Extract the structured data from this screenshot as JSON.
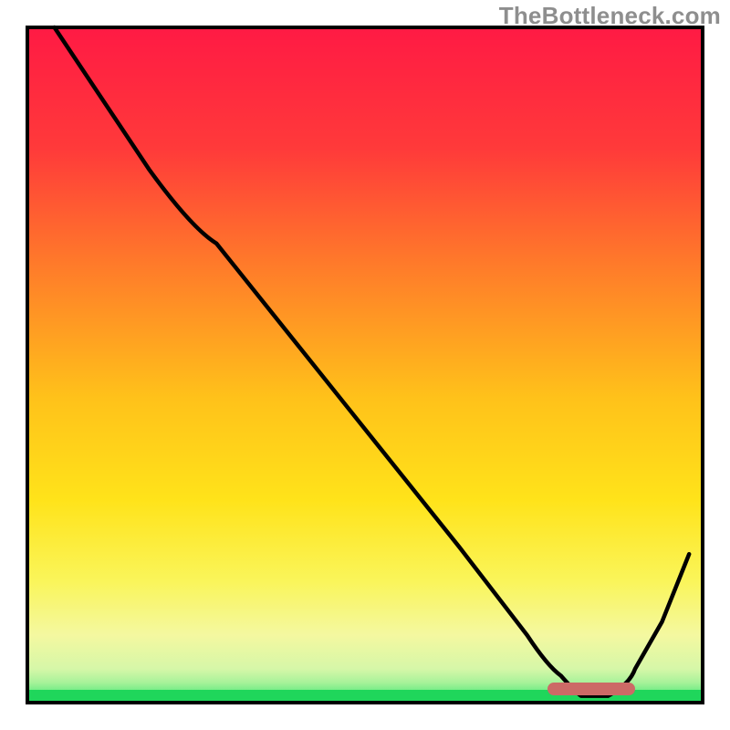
{
  "watermark": "TheBottleneck.com",
  "chart_data": {
    "type": "line",
    "title": "",
    "xlabel": "",
    "ylabel": "",
    "xlim": [
      0,
      100
    ],
    "ylim": [
      0,
      100
    ],
    "grid": false,
    "legend": false,
    "background": {
      "description": "Vertical gradient red → orange → yellow → green with thin green bottom band",
      "stops": [
        {
          "offset": 0,
          "color": "#ff1a44"
        },
        {
          "offset": 35,
          "color": "#ff7a2a"
        },
        {
          "offset": 65,
          "color": "#ffe31a"
        },
        {
          "offset": 85,
          "color": "#f8f86a"
        },
        {
          "offset": 95,
          "color": "#d8f890"
        },
        {
          "offset": 100,
          "color": "#2ee56a"
        }
      ]
    },
    "series": [
      {
        "name": "bottleneck-curve",
        "color": "#000000",
        "x": [
          4,
          10,
          18,
          28,
          40,
          52,
          64,
          74,
          79,
          82,
          86,
          90,
          94,
          98
        ],
        "y": [
          100,
          91,
          79,
          68,
          53,
          38,
          23,
          10,
          4,
          1,
          1,
          5,
          12,
          22
        ]
      }
    ],
    "annotations": [
      {
        "name": "optimal-region-marker",
        "shape": "rounded-bar",
        "color": "#cc6a66",
        "x_start": 77,
        "x_end": 90,
        "y": 2
      }
    ]
  }
}
